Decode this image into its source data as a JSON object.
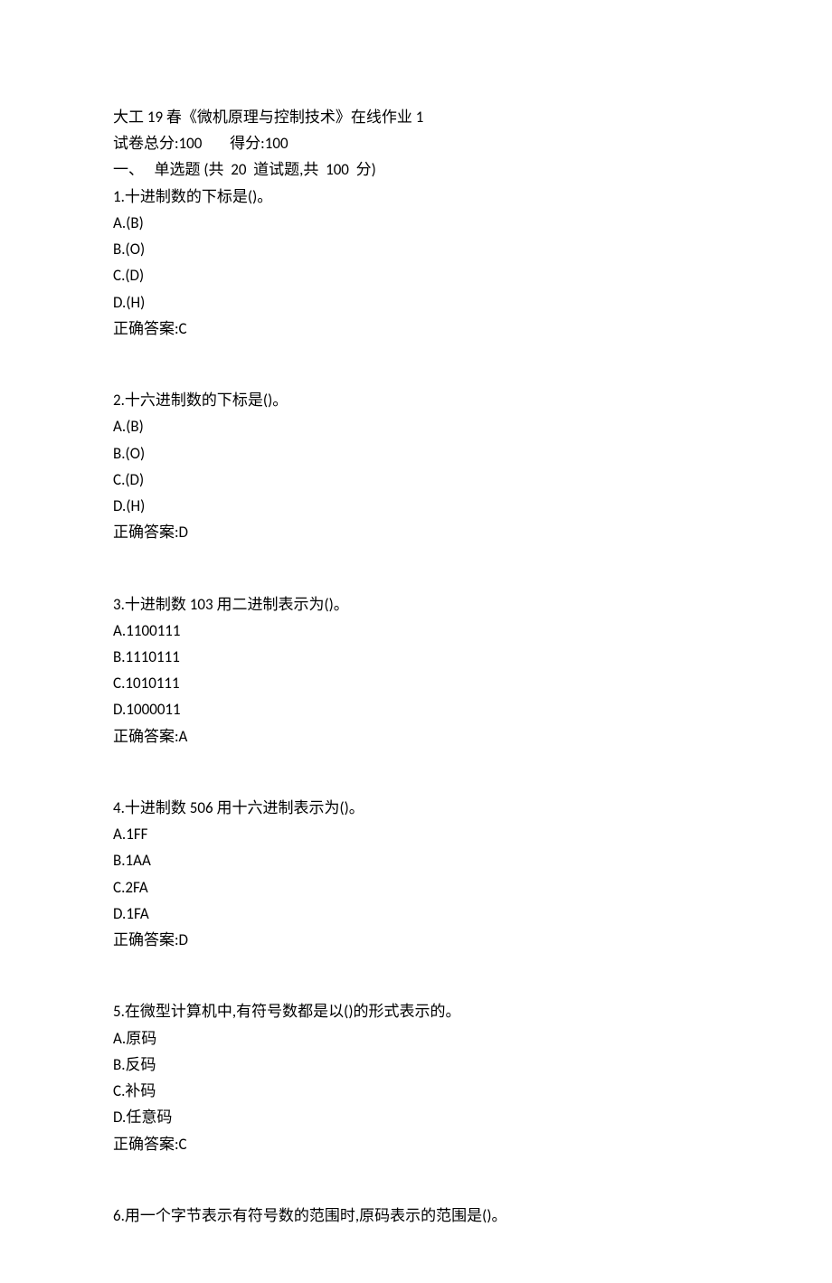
{
  "header": {
    "title_prefix": "大工",
    "title_mid": " 19 ",
    "title_cn2": "春《微机原理与控制技术》在线作业",
    "title_suffix": " 1",
    "score_line_cn1": "试卷总分",
    "score_line_val1": ":100",
    "score_line_gap": "        ",
    "score_line_cn2": "得分",
    "score_line_val2": ":100",
    "section_cn1": "一、",
    "section_gap": "   ",
    "section_cn2": "单选题",
    "section_paren1": " (",
    "section_cn3": "共",
    "section_mid1": "  20  ",
    "section_cn4": "道试题",
    "section_comma": ",",
    "section_cn5": "共",
    "section_mid2": "  100  ",
    "section_cn6": "分",
    "section_paren2": ")"
  },
  "questions": [
    {
      "num": "1.",
      "stem": "十进制数的下标是",
      "stem_suffix": "()。",
      "options": [
        "A.(B)",
        "B.(O)",
        "C.(D)",
        "D.(H)"
      ],
      "answer_label": "正确答案",
      "answer_value": ":C"
    },
    {
      "num": "2.",
      "stem": "十六进制数的下标是",
      "stem_suffix": "()。",
      "options": [
        "A.(B)",
        "B.(O)",
        "C.(D)",
        "D.(H)"
      ],
      "answer_label": "正确答案",
      "answer_value": ":D"
    },
    {
      "num": "3.",
      "stem_cn1": "十进制数",
      "stem_mid": " 103 ",
      "stem_cn2": "用二进制表示为",
      "stem_suffix": "()。",
      "options": [
        "A.1100111",
        "B.1110111",
        "C.1010111",
        "D.1000011"
      ],
      "answer_label": "正确答案",
      "answer_value": ":A"
    },
    {
      "num": "4.",
      "stem_cn1": "十进制数",
      "stem_mid": " 506 ",
      "stem_cn2": "用十六进制表示为",
      "stem_suffix": "()。",
      "options": [
        "A.1FF",
        "B.1AA",
        "C.2FA",
        "D.1FA"
      ],
      "answer_label": "正确答案",
      "answer_value": ":D"
    },
    {
      "num": "5.",
      "stem_cn1": "在微型计算机中",
      "stem_comma": ",",
      "stem_cn2": "有符号数都是以",
      "stem_paren": "()",
      "stem_cn3": "的形式表示的。",
      "options_cn": [
        {
          "pre": "A.",
          "cn": "原码"
        },
        {
          "pre": "B.",
          "cn": "反码"
        },
        {
          "pre": "C.",
          "cn": "补码"
        },
        {
          "pre": "D.",
          "cn": "任意码"
        }
      ],
      "answer_label": "正确答案",
      "answer_value": ":C"
    },
    {
      "num": "6.",
      "stem_cn1": "用一个字节表示有符号数的范围时",
      "stem_comma": ",",
      "stem_cn2": "原码表示的范围是",
      "stem_suffix": "()。"
    }
  ]
}
